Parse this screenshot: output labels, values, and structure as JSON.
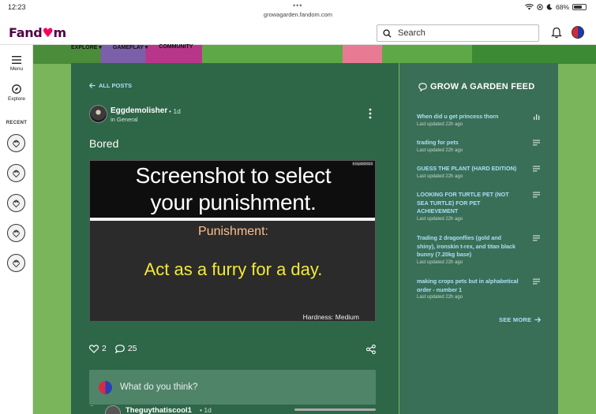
{
  "status_bar": {
    "time": "12:23",
    "dots": "•••",
    "url": "growagarden.fandom.com",
    "battery": "68%",
    "battery_level": 0.68
  },
  "header": {
    "logo_prefix": "Fand",
    "logo_suffix": "m",
    "search_placeholder": "Search"
  },
  "wiki_nav": {
    "items": [
      "EXPLORE ▾",
      "GAMEPLAY ▾",
      "COMMUNITY"
    ]
  },
  "rail": {
    "menu_label": "Menu",
    "explore_label": "Explore",
    "recent_label": "RECENT"
  },
  "post": {
    "back_label": "ALL POSTS",
    "author": "Eggdemolisher",
    "time": "• 1d",
    "category": "in General",
    "title": "Bored",
    "image": {
      "tag": "Kraydel2022",
      "line1": "Screenshot to select",
      "line2": "your punishment.",
      "punishment": "Punishment:",
      "act": "Act as a furry for a day.",
      "hardness": "Hardness: Medium"
    },
    "likes": "2",
    "comments": "25",
    "comment_placeholder": "What do you think?",
    "next_comment": {
      "count": "2",
      "author": "Theguythatiscool1",
      "time": "• 1d"
    }
  },
  "feed": {
    "title": "GROW A GARDEN FEED",
    "items": [
      {
        "title": "When did u get princess thorn",
        "updated": "Last updated 22h ago",
        "icon": "poll-icon"
      },
      {
        "title": "trading for pets",
        "updated": "Last updated 22h ago",
        "icon": "text-icon"
      },
      {
        "title": "GUESS THE PLANT (HARD EDITION)",
        "updated": "Last updated 22h ago",
        "icon": "text-icon"
      },
      {
        "title": "LOOKING FOR TURTLE PET (NOT SEA TURTLE) FOR PET ACHIEVEMENT",
        "updated": "Last updated 22h ago",
        "icon": "text-icon"
      },
      {
        "title": "Trading 2 dragonflies (gold and shiny), ironskin t-rex, and titan black bunny (7.20kg base)",
        "updated": "Last updated 22h ago",
        "icon": "text-icon"
      },
      {
        "title": "making crops pets but in alphabetical order - number 1",
        "updated": "Last updated 22h ago",
        "icon": "text-icon"
      }
    ],
    "see_more": "SEE MORE"
  },
  "colors": {
    "post_bg": "#2e6648",
    "feed_bg": "#3a6f57",
    "link": "#a8e0f8",
    "brand": "#520044",
    "brand_accent": "#fa005a"
  }
}
